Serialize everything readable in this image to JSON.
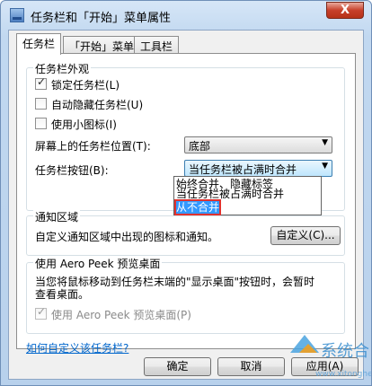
{
  "window": {
    "title": "任务栏和「开始」菜单属性",
    "close_label": "X"
  },
  "tabs": [
    {
      "label": "任务栏",
      "active": true
    },
    {
      "label": "「开始」菜单",
      "active": false
    },
    {
      "label": "工具栏",
      "active": false
    }
  ],
  "appearance": {
    "legend": "任务栏外观",
    "lock_label": "锁定任务栏(L)",
    "lock_checked": true,
    "autohide_label": "自动隐藏任务栏(U)",
    "autohide_checked": false,
    "small_icons_label": "使用小图标(I)",
    "small_icons_checked": false,
    "location_label": "屏幕上的任务栏位置(T):",
    "location_value": "底部",
    "buttons_label": "任务栏按钮(B):",
    "buttons_value": "当任务栏被占满时合并",
    "buttons_options": [
      "始终合并、隐藏标签",
      "当任务栏被占满时合并",
      "从不合并"
    ],
    "buttons_highlighted_option": "从不合并"
  },
  "notification": {
    "legend": "通知区域",
    "description": "自定义通知区域中出现的图标和通知。",
    "customize_button": "自定义(C)..."
  },
  "aero_peek": {
    "legend": "使用 Aero Peek 预览桌面",
    "description_line1": "当您将鼠标移动到任务栏末端的\"显示桌面\"按钮时，会暂时",
    "description_line2": "查看桌面。",
    "checkbox_label": "使用 Aero Peek 预览桌面(P)",
    "checkbox_checked": true,
    "checkbox_disabled": true
  },
  "help_link": "如何自定义该任务栏?",
  "footer": {
    "ok_button": "确定",
    "cancel_button": "取消",
    "apply_button": "应用(A)"
  },
  "watermark": {
    "brand": "系统合",
    "url": "www.xitonghe.com"
  },
  "colors": {
    "accent": "#3399ff",
    "highlight_border": "#e0322f",
    "link": "#0066cc"
  }
}
